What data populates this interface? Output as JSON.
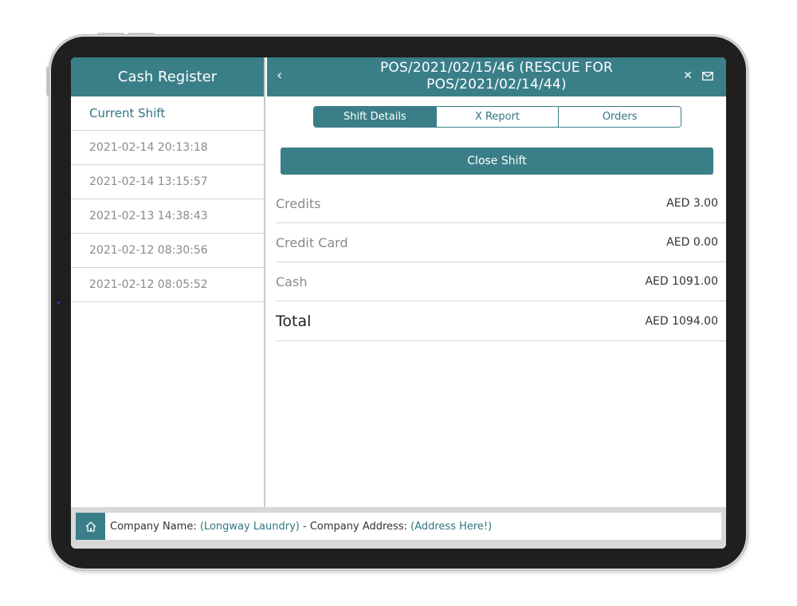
{
  "sidebar": {
    "title": "Cash Register",
    "items": [
      {
        "label": "Current Shift"
      },
      {
        "label": "2021-02-14 20:13:18"
      },
      {
        "label": "2021-02-14 13:15:57"
      },
      {
        "label": "2021-02-13 14:38:43"
      },
      {
        "label": "2021-02-12 08:30:56"
      },
      {
        "label": "2021-02-12 08:05:52"
      }
    ]
  },
  "header": {
    "title": "POS/2021/02/15/46 (RESCUE FOR POS/2021/02/14/44)",
    "back_icon": "chevron-left-icon",
    "close_icon": "close-icon",
    "mail_icon": "mail-icon"
  },
  "tabs": [
    {
      "label": "Shift Details"
    },
    {
      "label": "X Report"
    },
    {
      "label": "Orders"
    }
  ],
  "close_shift_label": "Close Shift",
  "summary": [
    {
      "label": "Credits",
      "value": "AED 3.00"
    },
    {
      "label": "Credit Card",
      "value": "AED 0.00"
    },
    {
      "label": "Cash",
      "value": "AED 1091.00"
    },
    {
      "label": "Total",
      "value": "AED 1094.00"
    }
  ],
  "footer": {
    "home_icon": "home-icon",
    "company_name_label": "Company Name:",
    "company_name": "(Longway Laundry)",
    "separator": " - ",
    "company_address_label": "Company Address:",
    "company_address": "(Address Here!)"
  },
  "colors": {
    "accent": "#3a7f88"
  }
}
